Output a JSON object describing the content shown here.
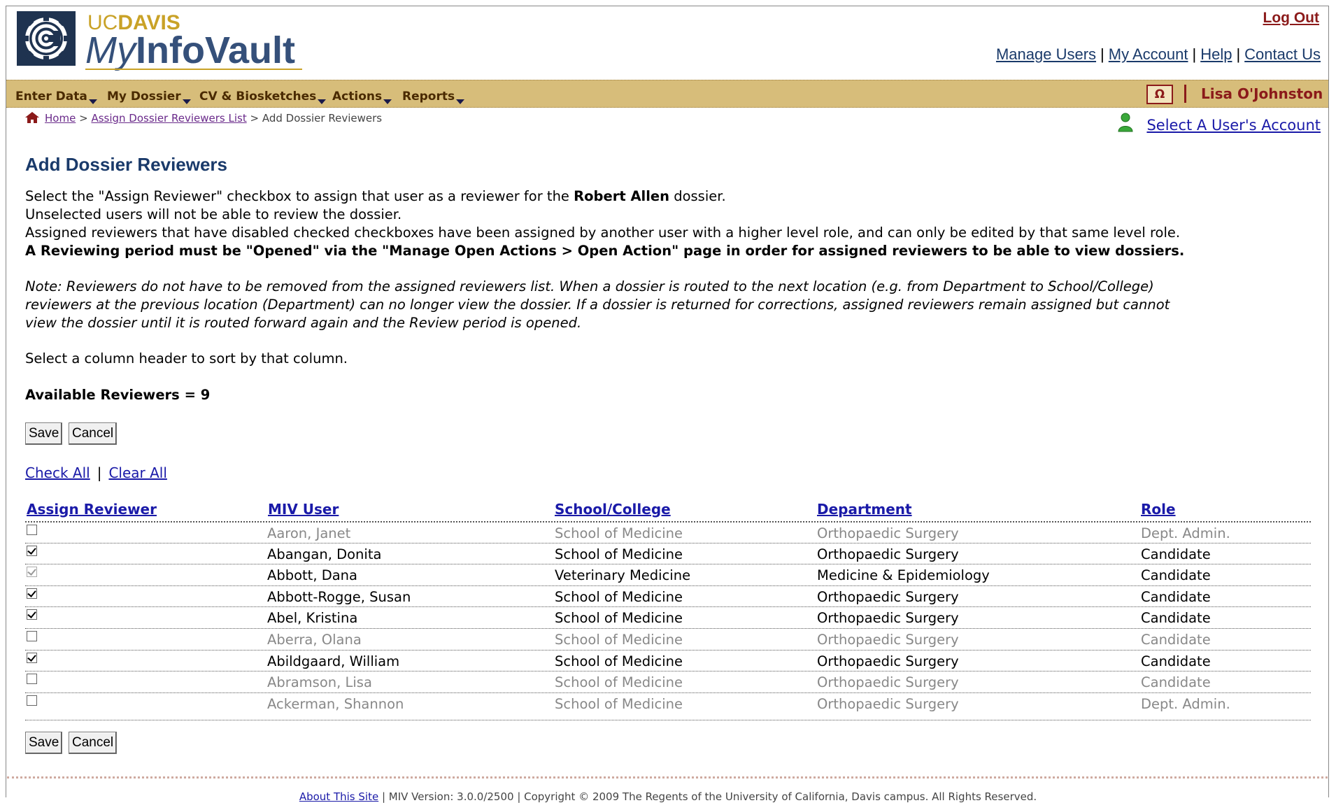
{
  "header": {
    "logo_uc": "UC",
    "logo_davis": "DAVIS",
    "logo_my": "My",
    "logo_infovault": "InfoVault",
    "logout": "Log Out",
    "links": [
      "Manage Users",
      "My Account",
      "Help",
      "Contact Us"
    ],
    "sep": "|"
  },
  "menu": {
    "items": [
      "Enter Data",
      "My Dossier",
      "CV & Biosketches",
      "Actions",
      "Reports"
    ],
    "omega": "Ω",
    "user": "Lisa O'Johnston"
  },
  "breadcrumb": {
    "home": "Home",
    "sep1": ">",
    "list": "Assign Dossier Reviewers List",
    "sep2": ">",
    "current": "Add Dossier Reviewers"
  },
  "select_account": "Select A User's Account",
  "page_title": "Add Dossier Reviewers",
  "instructions": {
    "line1_pre": "Select the \"Assign Reviewer\" checkbox to assign that user as a reviewer for the ",
    "line1_name": "Robert Allen",
    "line1_post": " dossier.",
    "line2": "Unselected users will not be able to review the dossier.",
    "line3": "Assigned reviewers that have disabled checked checkboxes have been assigned by another user with a higher level role, and can only be edited by that same level role.",
    "line4": "A Reviewing period must be \"Opened\" via the \"Manage Open Actions > Open Action\" page in order for assigned reviewers to be able to view dossiers.",
    "note1": "Note: Reviewers do not have to be removed from the assigned reviewers list. When a dossier is routed to the next location (e.g. from Department to School/College)",
    "note2": "reviewers at the previous location (Department) can no longer view the dossier. If a dossier is returned for corrections, assigned reviewers remain assigned but cannot",
    "note3": "view the dossier until it is routed forward again and the Review period is opened.",
    "sort_hint": "Select a column header to sort by that column.",
    "available": "Available Reviewers = 9"
  },
  "buttons": {
    "save": "Save",
    "cancel": "Cancel"
  },
  "check_links": {
    "check_all": "Check All",
    "sep": "|",
    "clear_all": "Clear All"
  },
  "table": {
    "headers": [
      "Assign Reviewer",
      "MIV User",
      "School/College",
      "Department",
      "Role"
    ],
    "rows": [
      {
        "checked": false,
        "disabled": false,
        "dim": true,
        "user": "Aaron, Janet",
        "school": "School of Medicine",
        "dept": "Orthopaedic Surgery",
        "role": "Dept. Admin."
      },
      {
        "checked": true,
        "disabled": false,
        "dim": false,
        "user": "Abangan, Donita",
        "school": "School of Medicine",
        "dept": "Orthopaedic Surgery",
        "role": "Candidate"
      },
      {
        "checked": true,
        "disabled": true,
        "dim": false,
        "user": "Abbott, Dana",
        "school": "Veterinary Medicine",
        "dept": "Medicine & Epidemiology",
        "role": "Candidate"
      },
      {
        "checked": true,
        "disabled": false,
        "dim": false,
        "user": "Abbott-Rogge, Susan",
        "school": "School of Medicine",
        "dept": "Orthopaedic Surgery",
        "role": "Candidate"
      },
      {
        "checked": true,
        "disabled": false,
        "dim": false,
        "user": "Abel, Kristina",
        "school": "School of Medicine",
        "dept": "Orthopaedic Surgery",
        "role": "Candidate"
      },
      {
        "checked": false,
        "disabled": false,
        "dim": true,
        "user": "Aberra, Olana",
        "school": "School of Medicine",
        "dept": "Orthopaedic Surgery",
        "role": "Candidate"
      },
      {
        "checked": true,
        "disabled": false,
        "dim": false,
        "user": "Abildgaard, William",
        "school": "School of Medicine",
        "dept": "Orthopaedic Surgery",
        "role": "Candidate"
      },
      {
        "checked": false,
        "disabled": false,
        "dim": true,
        "user": "Abramson, Lisa",
        "school": "School of Medicine",
        "dept": "Orthopaedic Surgery",
        "role": "Candidate"
      },
      {
        "checked": false,
        "disabled": false,
        "dim": true,
        "user": "Ackerman, Shannon",
        "school": "School of Medicine",
        "dept": "Orthopaedic Surgery",
        "role": "Dept. Admin."
      }
    ]
  },
  "footer": {
    "about": "About This Site",
    "rest": " | MIV Version: 3.0.0/2500 | Copyright © 2009 The Regents of the University of California, Davis campus. All Rights Reserved."
  }
}
